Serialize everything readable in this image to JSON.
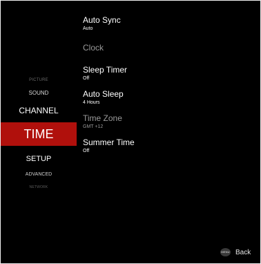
{
  "nav": {
    "picture": "PICTURE",
    "sound": "SOUND",
    "channel": "CHANNEL",
    "time": "TIME",
    "setup": "SETUP",
    "advanced": "ADVANCED",
    "network": "NETWORK"
  },
  "settings": {
    "auto_sync": {
      "label": "Auto Sync",
      "value": "Auto"
    },
    "clock": {
      "label": "Clock"
    },
    "sleep_timer": {
      "label": "Sleep Timer",
      "value": "Off"
    },
    "auto_sleep": {
      "label": "Auto Sleep",
      "value": "4 Hours"
    },
    "time_zone": {
      "label": "Time Zone",
      "value": "GMT +12"
    },
    "summer_time": {
      "label": "Summer Time",
      "value": "Off"
    }
  },
  "footer": {
    "menu_button": "MENU",
    "back_label": "Back"
  },
  "colors": {
    "background": "#000000",
    "selected": "#b0100c",
    "disabled_text": "#9a9a9a"
  }
}
